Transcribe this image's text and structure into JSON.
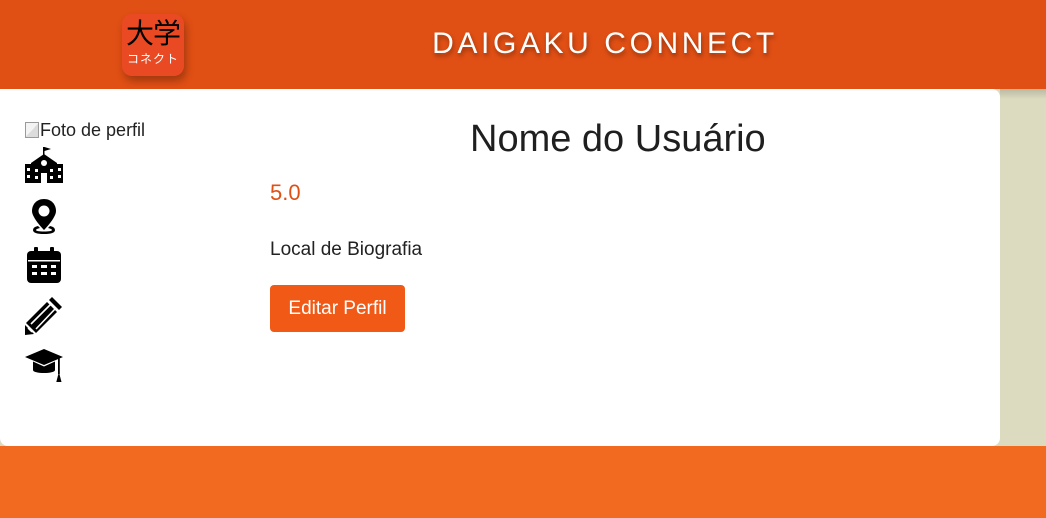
{
  "header": {
    "logo": {
      "kanji": "大学",
      "kana": "コネクト"
    },
    "title": "DAIGAKU CONNECT"
  },
  "profile": {
    "photo_alt": "Foto de perfil",
    "name": "Nome do Usuário",
    "rating": "5.0",
    "bio": "Local de Biografia",
    "edit_button": "Editar Perfil",
    "icons": [
      "school-icon",
      "location-pin-icon",
      "calendar-icon",
      "pencil-icon",
      "graduation-cap-icon"
    ]
  },
  "colors": {
    "header": "#e04f14",
    "footer": "#f26a1f",
    "accent": "#f05a16",
    "background": "#dcdbc0"
  }
}
